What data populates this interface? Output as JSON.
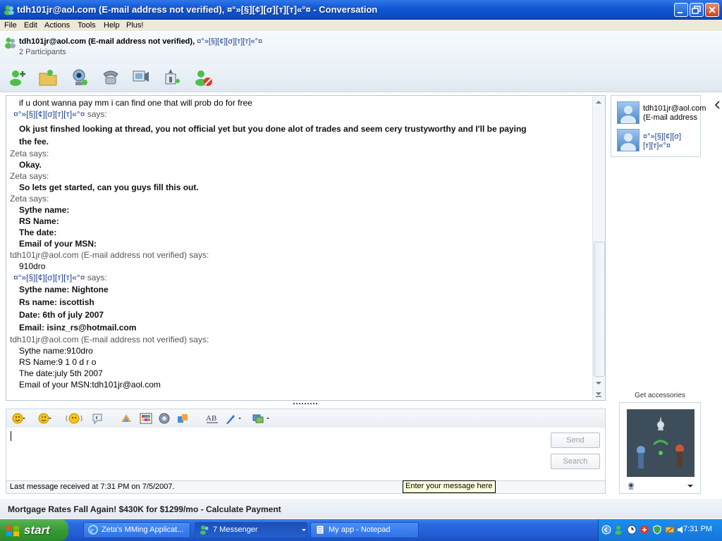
{
  "window": {
    "title": "tdh101jr@aol.com (E-mail address not verified),  ¤°»[§][¢][σ][т][т]«°¤ - Conversation"
  },
  "menu": [
    "File",
    "Edit",
    "Actions",
    "Tools",
    "Help",
    "Plus!"
  ],
  "header": {
    "contact": "tdh101jr@aol.com (E-mail address not verified),",
    "contact_ascii": "¤°»[§][¢][σ][т][т]«°¤",
    "participants": "2 Participants"
  },
  "conversation": {
    "messages": [
      {
        "kind": "text",
        "text": "if u dont wanna pay mm i can find one that will prob do for free"
      },
      {
        "kind": "says-ascii",
        "name": "¤°»[§][¢][σ][т][т]«°¤",
        "suffix": "says:"
      },
      {
        "kind": "bold",
        "text": "Ok just finshed looking at thread, you not official yet      but you done alot of trades and seem cery trustyworthy and I'll be paying"
      },
      {
        "kind": "bold",
        "text": "the fee."
      },
      {
        "kind": "says",
        "text": "Zeta says:"
      },
      {
        "kind": "bold",
        "text": "Okay."
      },
      {
        "kind": "says",
        "text": "Zeta says:"
      },
      {
        "kind": "bold",
        "text": "So lets get started, can you guys fill this out."
      },
      {
        "kind": "says",
        "text": "Zeta says:"
      },
      {
        "kind": "bold",
        "text": "Sythe name:"
      },
      {
        "kind": "bold",
        "text": "RS Name:"
      },
      {
        "kind": "bold",
        "text": "The date:"
      },
      {
        "kind": "bold",
        "text": "Email of your MSN:"
      },
      {
        "kind": "says",
        "text": "tdh101jr@aol.com (E-mail address not verified) says:"
      },
      {
        "kind": "text",
        "text": "910dro"
      },
      {
        "kind": "says-ascii",
        "name": "¤°»[§][¢][σ][т][т]«°¤",
        "suffix": "says:"
      },
      {
        "kind": "bold",
        "text": "Sythe name: Nightone"
      },
      {
        "kind": "bold",
        "text": "Rs name: iscottish"
      },
      {
        "kind": "bold",
        "text": "Date: 6th of july 2007"
      },
      {
        "kind": "bold",
        "text": "Email: isinz_rs@hotmail.com"
      },
      {
        "kind": "says",
        "text": "tdh101jr@aol.com (E-mail address not verified) says:"
      },
      {
        "kind": "text",
        "text": "Sythe name:910dro"
      },
      {
        "kind": "text",
        "text": "RS Name:9 1 0 d r o"
      },
      {
        "kind": "text",
        "text": "The date:july 5th 2007"
      },
      {
        "kind": "text",
        "text": "Email of your MSN:tdh101jr@aol.com"
      }
    ]
  },
  "side_panel": {
    "contact1_line1": "tdh101jr@aol.com",
    "contact1_line2": "(E-mail address",
    "contact2_line1": "¤°»[§][¢][σ]",
    "contact2_line2": "[т][т]«°¤"
  },
  "accessories": {
    "label": "Get accessories"
  },
  "input": {
    "send_label": "Send",
    "search_label": "Search",
    "status": "Last message received at 7:31 PM on 7/5/2007.",
    "tooltip": "Enter your message here"
  },
  "ad": {
    "text": "Mortgage Rates Fall Again! $430K for $1299/mo - Calculate Payment"
  },
  "taskbar": {
    "start": "start",
    "tasks": [
      "Zeta's MMing Applicat...",
      "7 Messenger",
      "My app - Notepad"
    ],
    "clock": "7:31 PM"
  },
  "colors": {
    "title_blue": "#0b4cc4",
    "ascii_name": "#1b3d8f",
    "start_green": "#379b34",
    "tray_blue": "#1475d9"
  }
}
